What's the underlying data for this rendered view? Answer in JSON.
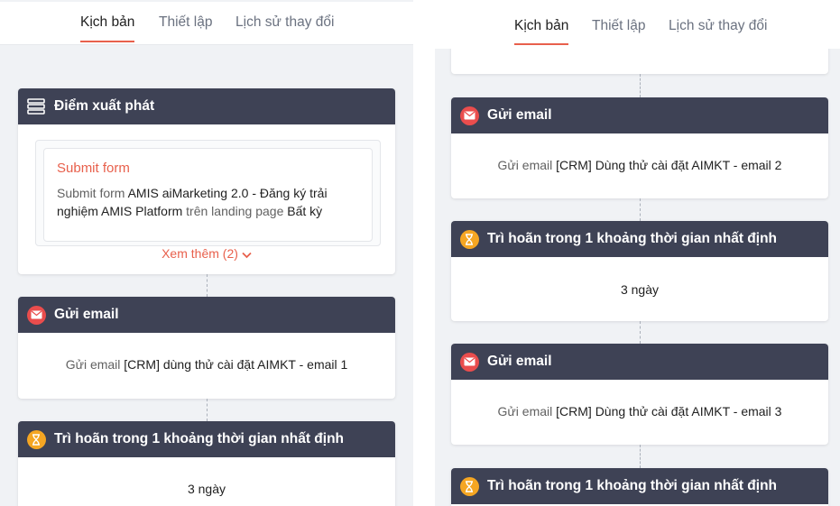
{
  "tabs": [
    {
      "label": "Kịch bản",
      "active": true
    },
    {
      "label": "Thiết lập",
      "active": false
    },
    {
      "label": "Lịch sử thay đổi",
      "active": false
    }
  ],
  "left": {
    "start": {
      "title": "Điểm xuất phát",
      "trigger_title": "Submit form",
      "desc_prefix": "Submit form",
      "desc_form": "AMIS aiMarketing 2.0 - Đăng ký trải nghiệm AMIS Platform",
      "desc_mid": "trên landing page",
      "desc_page": "Bất kỳ",
      "see_more": "Xem thêm (2)"
    },
    "email1": {
      "title": "Gửi email",
      "prefix": "Gửi email",
      "name": "[CRM] dùng thử cài đặt AIMKT - email 1"
    },
    "delay1": {
      "title": "Trì hoãn trong 1 khoảng thời gian nhất định",
      "value": "3 ngày"
    }
  },
  "right": {
    "email2": {
      "title": "Gửi email",
      "prefix": "Gửi email",
      "name": "[CRM] Dùng thử cài đặt AIMKT - email 2"
    },
    "delay2": {
      "title": "Trì hoãn trong 1 khoảng thời gian nhất định",
      "value": "3 ngày"
    },
    "email3": {
      "title": "Gửi email",
      "prefix": "Gửi email",
      "name": "[CRM] Dùng thử cài đặt AIMKT - email 3"
    },
    "delay3": {
      "title": "Trì hoãn trong 1 khoảng thời gian nhất định"
    }
  },
  "colors": {
    "accent": "#e8604c",
    "header": "#3e4255",
    "email_icon": "#ea4d4d",
    "timer_icon": "#f5a623",
    "canvas": "#f0f2f5"
  },
  "icons": [
    "list-icon",
    "email-icon",
    "hourglass-icon",
    "chevron-down-icon"
  ]
}
